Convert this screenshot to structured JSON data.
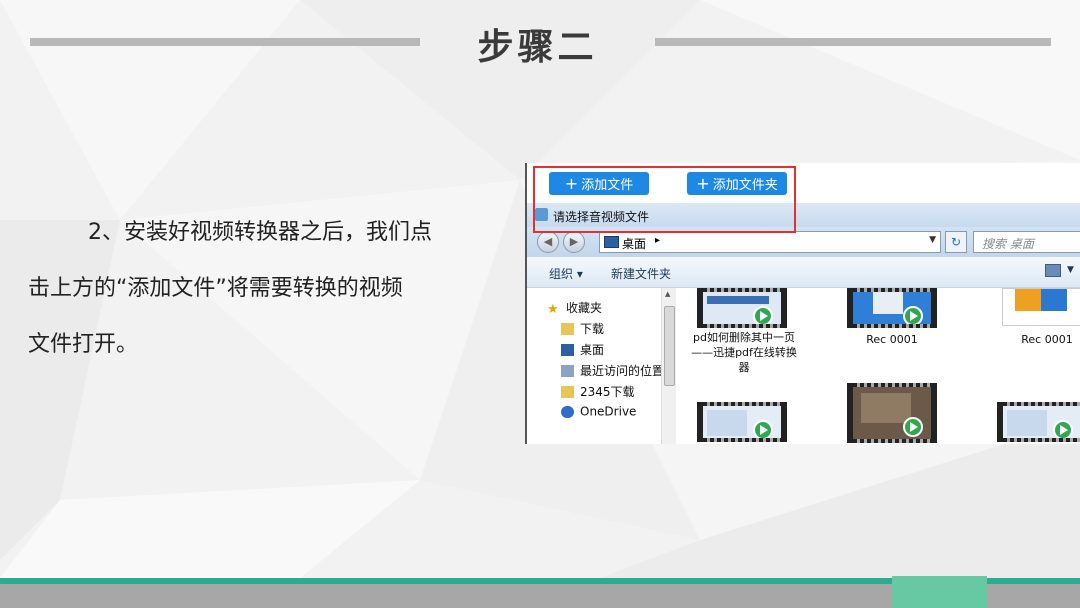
{
  "slide": {
    "title": "步骤二",
    "body_lines": [
      "2、安装好视频转换器之后，我们点",
      "击上方的“添加文件”将需要转换的视频",
      "文件打开。"
    ]
  },
  "app": {
    "add_file_label": "添加文件",
    "add_folder_label": "添加文件夹",
    "dialog_title": "请选择音视频文件",
    "address": "桌面",
    "search_placeholder": "搜索 桌面",
    "organize_label": "组织 ▾",
    "new_folder_label": "新建文件夹",
    "nav_items": [
      "收藏夹",
      "下载",
      "桌面",
      "最近访问的位置",
      "2345下载",
      "OneDrive"
    ],
    "files": [
      "pd如何删除其中一页——迅捷pdf在线转换器",
      "Rec 0001",
      "Rec 0001"
    ]
  },
  "colors": {
    "accent_blue": "#1e88e5",
    "highlight_red": "#e53030",
    "footer_green": "#2bab8f",
    "footer_gray": "#a7a7a7"
  }
}
